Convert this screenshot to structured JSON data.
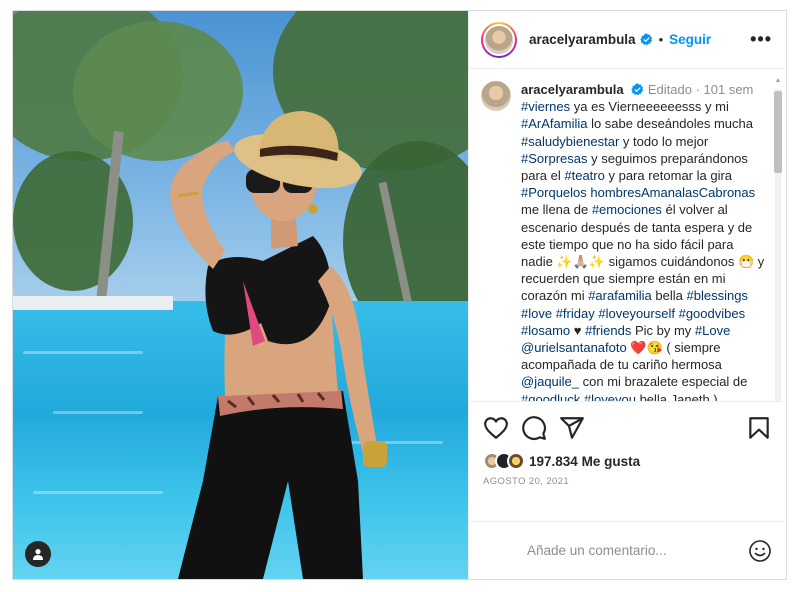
{
  "post": {
    "username": "aracelyarambula",
    "follow_label": "Seguir",
    "separator": "•",
    "more_label": "•••",
    "caption": {
      "username": "aracelyarambula",
      "meta": "Editado · 101 sem",
      "segments": [
        {
          "t": "#viernes",
          "tag": true
        },
        {
          "t": " ya es Vierneeeeeesss y mi ",
          "tag": false
        },
        {
          "t": "#ArAfamilia",
          "tag": true
        },
        {
          "t": " lo sabe deseándoles mucha ",
          "tag": false
        },
        {
          "t": "#saludybienestar",
          "tag": true
        },
        {
          "t": " y todo lo mejor ",
          "tag": false
        },
        {
          "t": "#Sorpresas",
          "tag": true
        },
        {
          "t": " y seguimos preparándonos para el ",
          "tag": false
        },
        {
          "t": "#teatro",
          "tag": true
        },
        {
          "t": " y para retomar la gira ",
          "tag": false
        },
        {
          "t": "#Porquelos hombresAmanalasCabronas",
          "tag": true
        },
        {
          "t": " me llena de ",
          "tag": false
        },
        {
          "t": "#emociones",
          "tag": true
        },
        {
          "t": " él volver al escenario después de tanta espera y de este tiempo que no ha sido fácil para nadie ✨🙏🏼✨ sigamos cuidándonos 😷 y recuerden que siempre están en mi corazón mi ",
          "tag": false
        },
        {
          "t": "#arafamilia",
          "tag": true
        },
        {
          "t": " bella ",
          "tag": false
        },
        {
          "t": "#blessings",
          "tag": true
        },
        {
          "t": " ",
          "tag": false
        },
        {
          "t": "#love",
          "tag": true
        },
        {
          "t": " ",
          "tag": false
        },
        {
          "t": "#friday",
          "tag": true
        },
        {
          "t": " ",
          "tag": false
        },
        {
          "t": "#loveyourself",
          "tag": true
        },
        {
          "t": " ",
          "tag": false
        },
        {
          "t": "#goodvibes",
          "tag": true
        },
        {
          "t": " ",
          "tag": false
        },
        {
          "t": "#losamo",
          "tag": true
        },
        {
          "t": " ♥ ",
          "tag": false
        },
        {
          "t": "#friends",
          "tag": true
        },
        {
          "t": " Pic by my ",
          "tag": false
        },
        {
          "t": "#Love",
          "tag": true
        },
        {
          "t": " ",
          "tag": false
        },
        {
          "t": "@urielsantanafoto",
          "tag": true
        },
        {
          "t": " ❤️😘 ( siempre acompañada de tu cariño hermosa ",
          "tag": false
        },
        {
          "t": "@jaquile_",
          "tag": true
        },
        {
          "t": " con mi brazalete especial de ",
          "tag": false
        },
        {
          "t": "#goodluck",
          "tag": true
        },
        {
          "t": " ",
          "tag": false
        },
        {
          "t": "#loveyou",
          "tag": true
        },
        {
          "t": " bella Janeth )",
          "tag": false
        }
      ]
    },
    "likes_count": "197.834",
    "likes_label": "Me gusta",
    "date": "AGOSTO 20, 2021",
    "comment_placeholder": "Añade un comentario..."
  },
  "icons": {
    "like": "heart-icon",
    "comment": "comment-bubble-icon",
    "share": "paper-plane-icon",
    "save": "bookmark-icon",
    "emoji": "smiley-icon",
    "verified": "verified-badge-icon",
    "user": "user-icon"
  },
  "colors": {
    "link": "#0095f6",
    "hashtag": "#00376b",
    "verified": "#0095f6",
    "muted": "#8e8e8e"
  }
}
